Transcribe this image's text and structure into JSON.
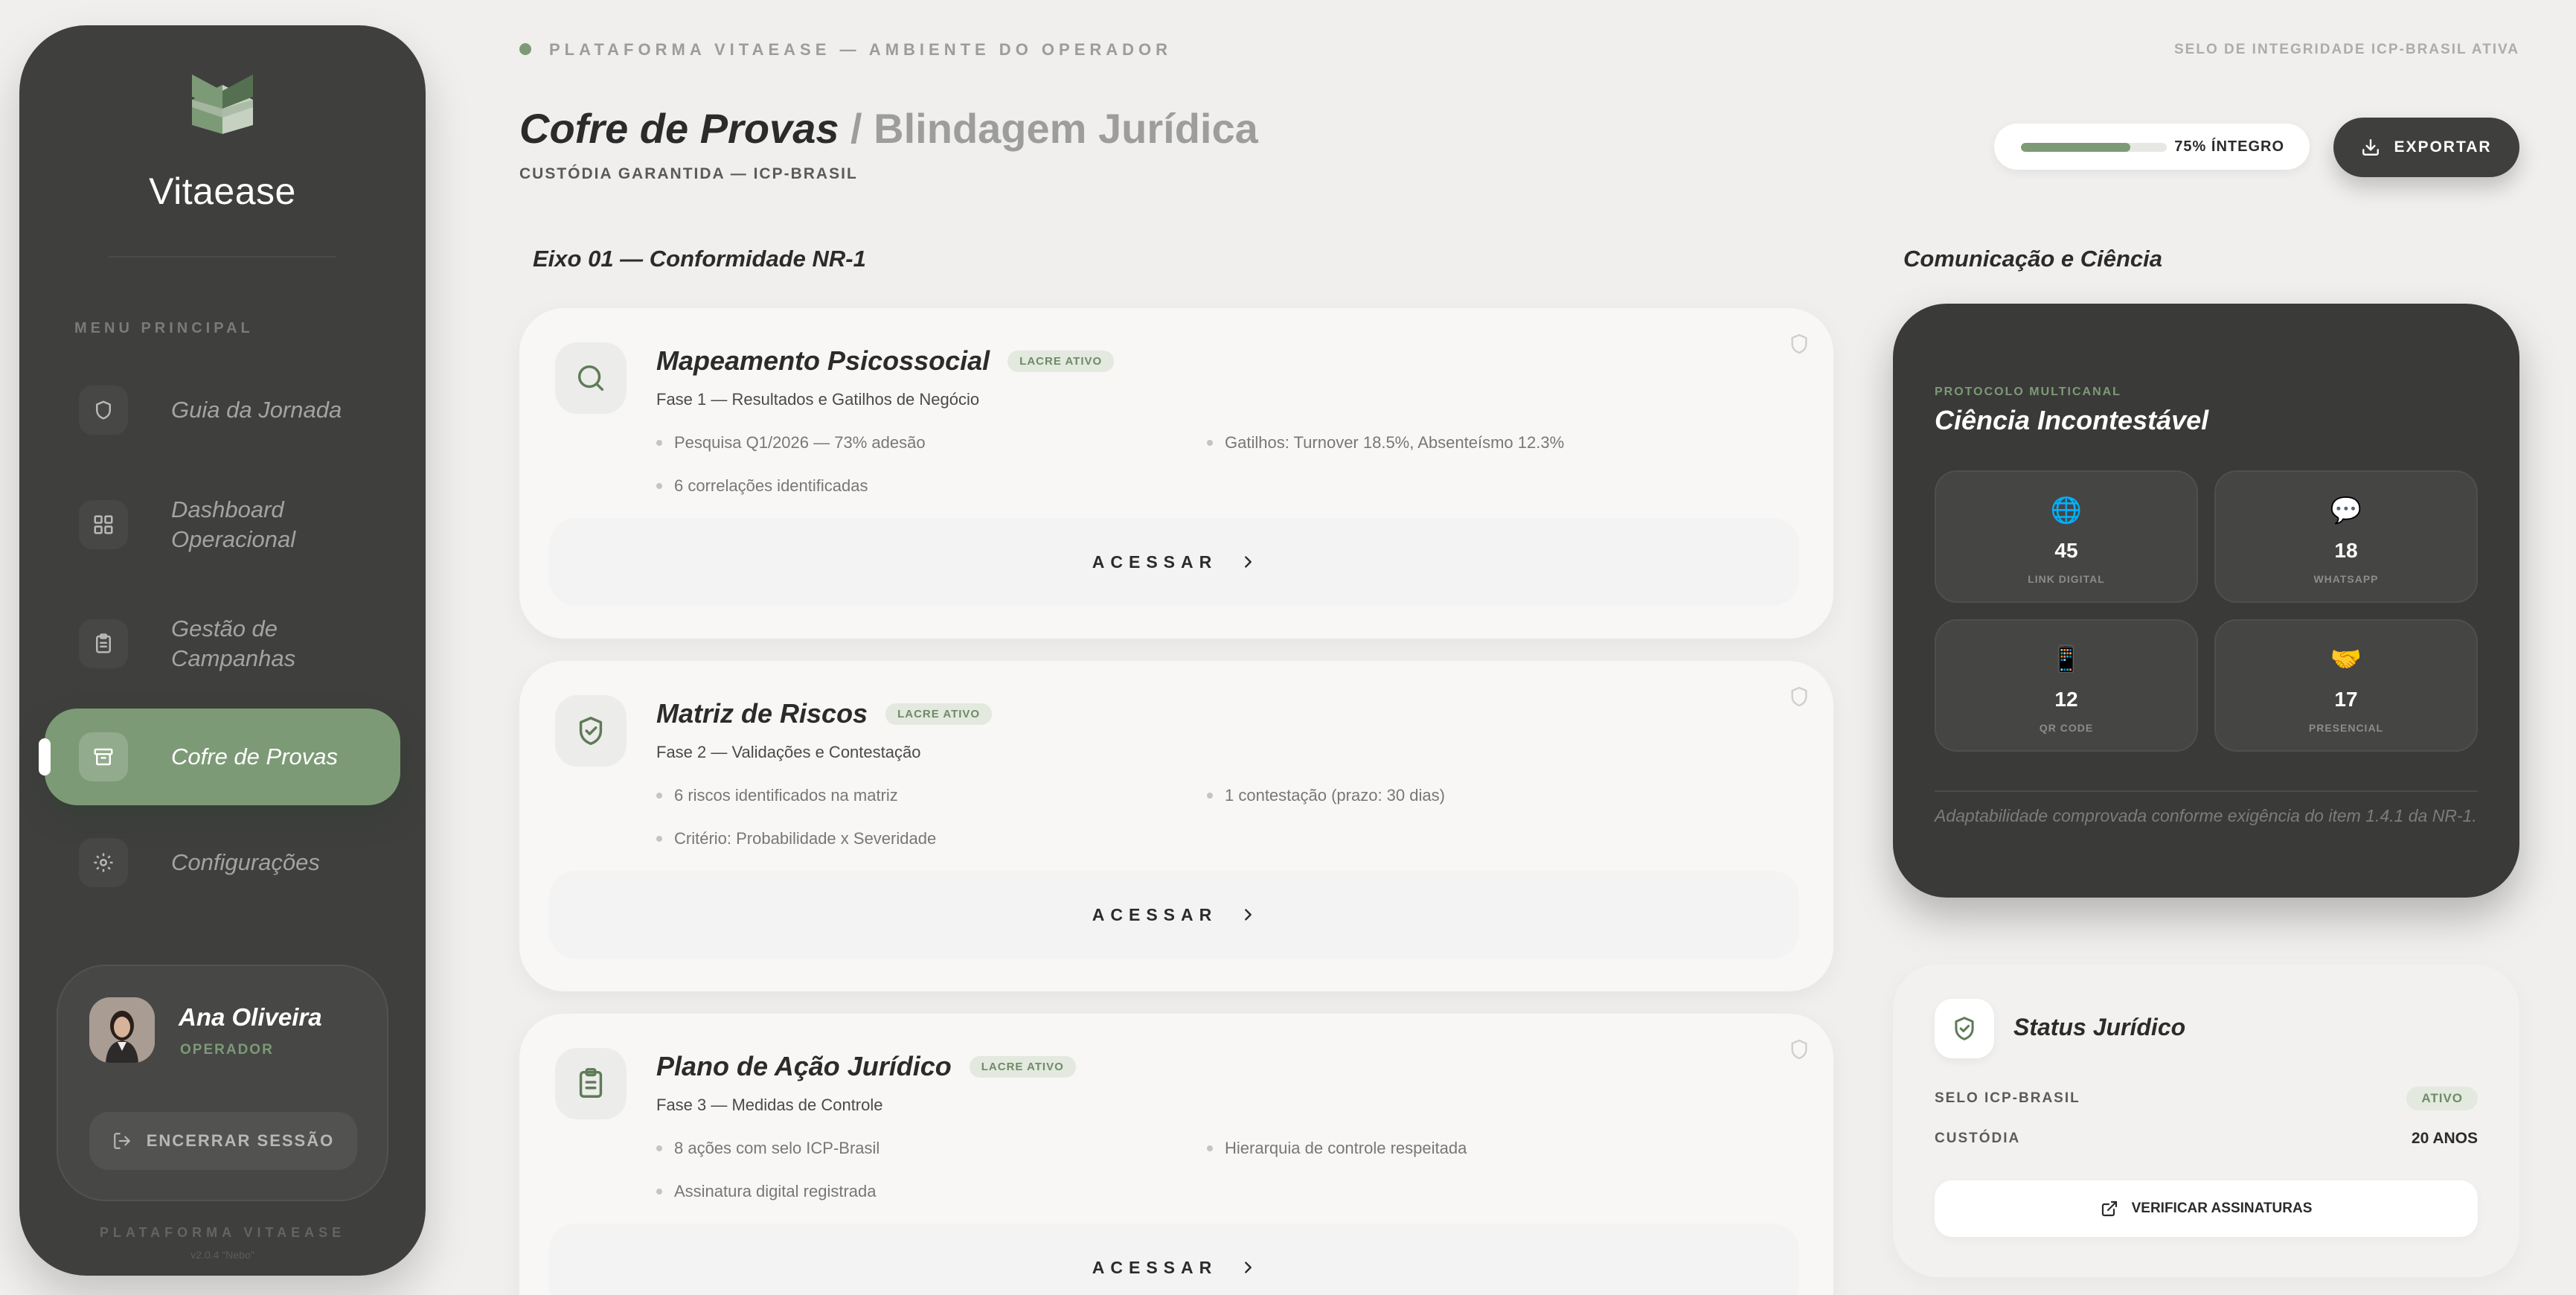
{
  "sidebar": {
    "brand": "Vitaease",
    "menu_heading": "MENU PRINCIPAL",
    "items": [
      {
        "label": "Guia da Jornada",
        "icon": "shield-icon"
      },
      {
        "label": "Dashboard Operacional",
        "icon": "grid-icon"
      },
      {
        "label": "Gestão de Campanhas",
        "icon": "clipboard-icon"
      },
      {
        "label": "Cofre de Provas",
        "icon": "archive-icon",
        "active": true
      },
      {
        "label": "Configurações",
        "icon": "gear-icon"
      }
    ],
    "user": {
      "name": "Ana Oliveira",
      "role": "OPERADOR",
      "logout_label": "ENCERRAR SESSÃO"
    },
    "footer": "PLATAFORMA VITAEASE",
    "version": "v2.0.4 \"Nebo\""
  },
  "header": {
    "top_label": "PLATAFORMA VITAEASE — AMBIENTE DO OPERADOR",
    "top_right": "SELO DE INTEGRIDADE ICP-BRASIL ATIVA",
    "title_strong": "Cofre de Provas",
    "title_light": " / Blindagem Jurídica",
    "subtitle": "CUSTÓDIA GARANTIDA — ICP-BRASIL",
    "integrity": {
      "percent": 75,
      "label": "75% ÍNTEGRO"
    },
    "export_label": "EXPORTAR"
  },
  "axis": {
    "title": "Eixo 01 — Conformidade NR-1",
    "cards": [
      {
        "title": "Mapeamento Psicossocial",
        "badge": "LACRE ATIVO",
        "phase": "Fase 1 — Resultados e Gatilhos de Negócio",
        "icon": "search-icon",
        "bullets": [
          "Pesquisa Q1/2026 — 73% adesão",
          "Gatilhos: Turnover 18.5%, Absenteísmo 12.3%",
          "6 correlações identificadas"
        ],
        "access_label": "ACESSAR"
      },
      {
        "title": "Matriz de Riscos",
        "badge": "LACRE ATIVO",
        "phase": "Fase 2 — Validações e Contestação",
        "icon": "shield-check-icon",
        "bullets": [
          "6 riscos identificados na matriz",
          "1 contestação (prazo: 30 dias)",
          "Critério: Probabilidade x Severidade"
        ],
        "access_label": "ACESSAR"
      },
      {
        "title": "Plano de Ação Jurídico",
        "badge": "LACRE ATIVO",
        "phase": "Fase 3 — Medidas de Controle",
        "icon": "clipboard-icon",
        "bullets": [
          "8 ações com selo ICP-Brasil",
          "Hierarquia de controle respeitada",
          "Assinatura digital registrada"
        ],
        "access_label": "ACESSAR"
      }
    ]
  },
  "communication": {
    "section_title": "Comunicação e Ciência",
    "protocol": "PROTOCOLO MULTICANAL",
    "title": "Ciência Incontestável",
    "channels": [
      {
        "icon": "globe-icon",
        "glyph": "🌐",
        "value": "45",
        "label": "LINK DIGITAL"
      },
      {
        "icon": "chat-bubble-icon",
        "glyph": "💬",
        "value": "18",
        "label": "WHATSAPP"
      },
      {
        "icon": "phone-icon",
        "glyph": "📱",
        "value": "12",
        "label": "QR CODE"
      },
      {
        "icon": "handshake-icon",
        "glyph": "🤝",
        "value": "17",
        "label": "PRESENCIAL"
      }
    ],
    "note": "Adaptabilidade comprovada conforme exigência do item 1.4.1 da NR-1."
  },
  "status": {
    "title": "Status Jurídico",
    "rows": [
      {
        "key": "SELO ICP-BRASIL",
        "value": "ATIVO"
      },
      {
        "key": "CUSTÓDIA",
        "value": "20 ANOS"
      }
    ],
    "verify_label": "VERIFICAR ASSINATURAS"
  },
  "colors": {
    "accent": "#7d9a76",
    "sidebar": "#3f3f3e",
    "background": "#f0efed"
  }
}
